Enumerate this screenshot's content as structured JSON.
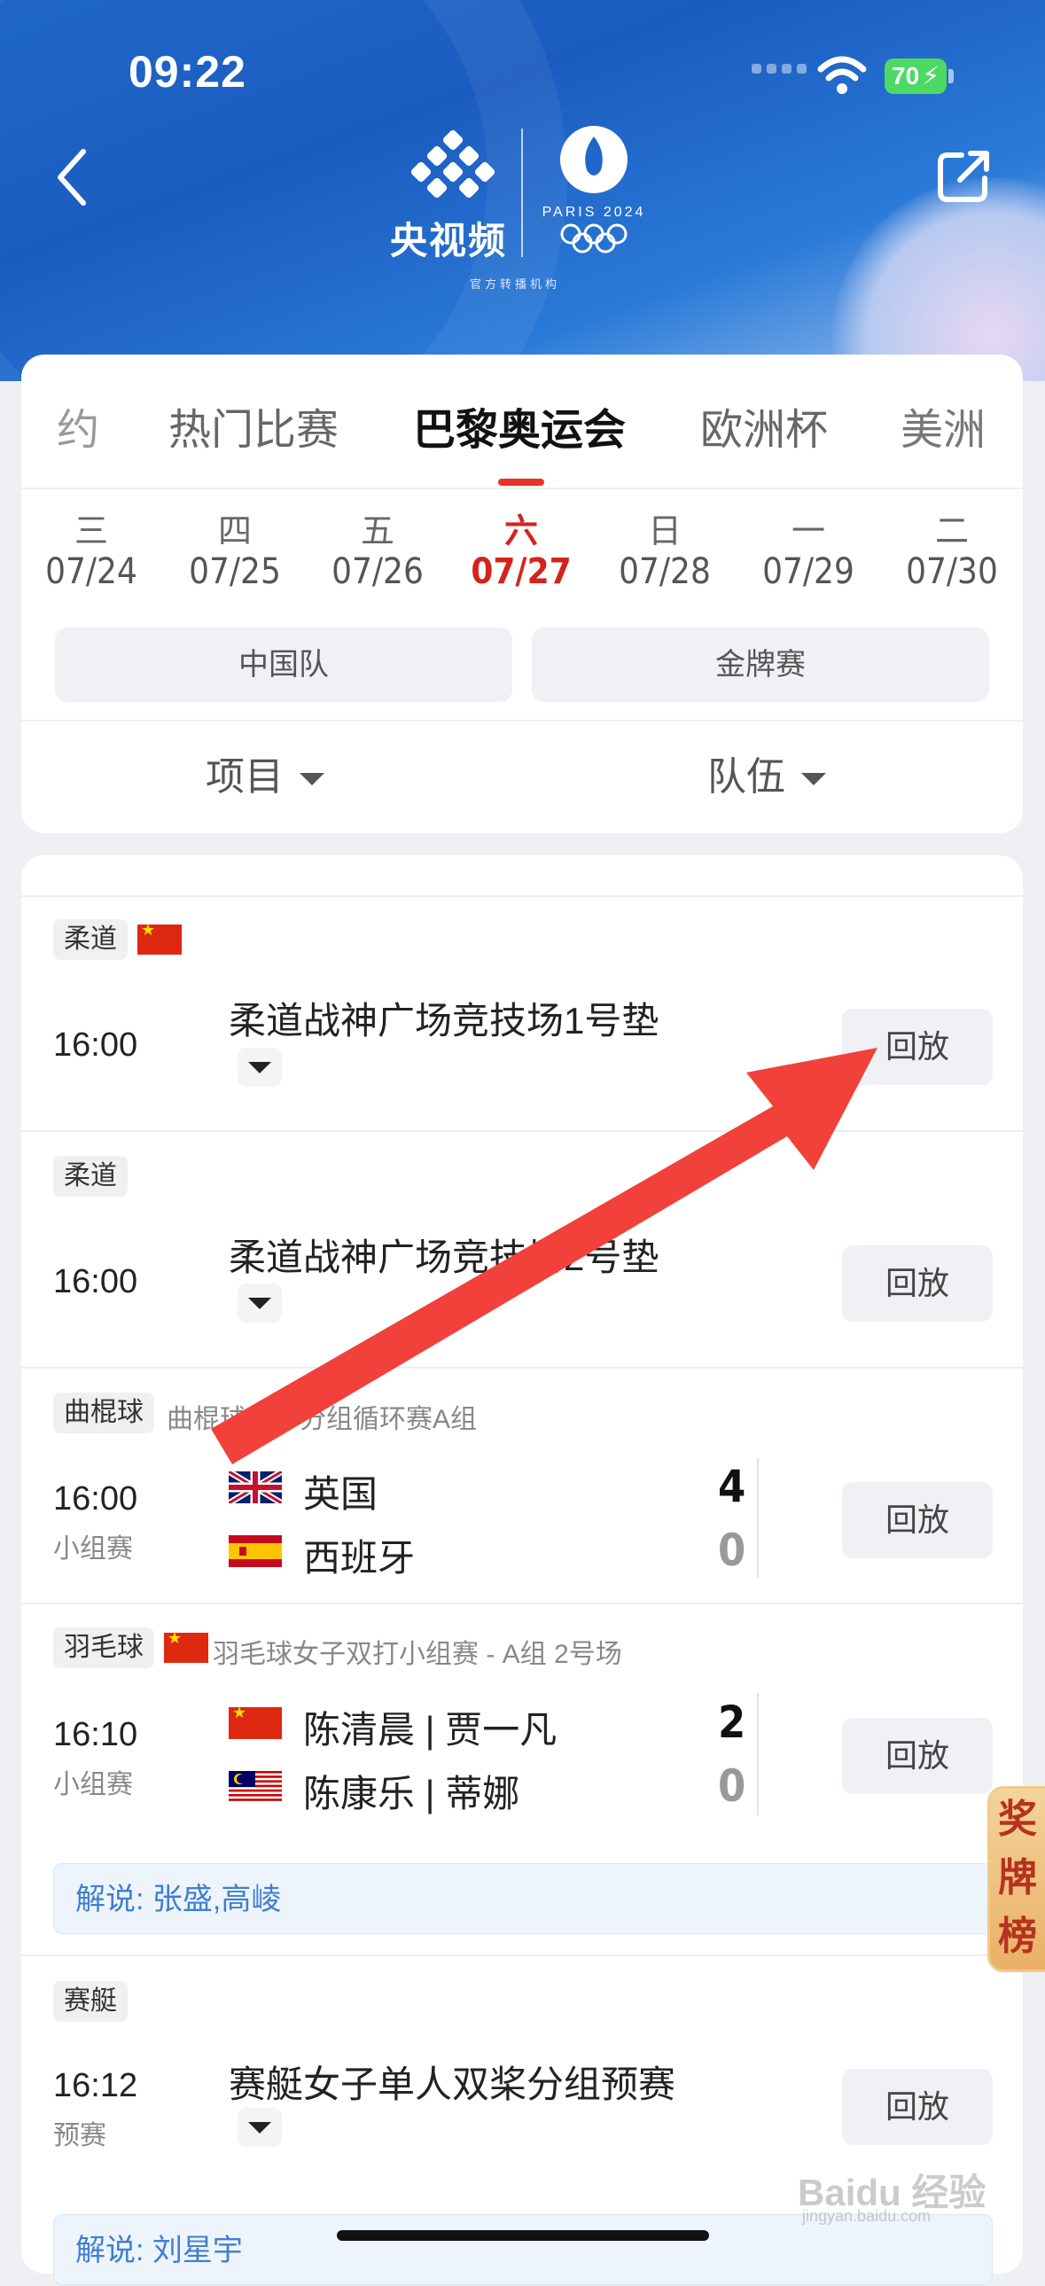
{
  "status": {
    "time": "09:22",
    "battery": "70"
  },
  "header": {
    "brand_name": "央视频",
    "brand_sub": "官方转播机构",
    "paris_label": "PARIS 2024"
  },
  "tabs": [
    "约",
    "热门比赛",
    "巴黎奥运会",
    "欧洲杯",
    "美洲"
  ],
  "active_tab": "巴黎奥运会",
  "days": [
    {
      "wk": "三",
      "dt": "07/24"
    },
    {
      "wk": "四",
      "dt": "07/25"
    },
    {
      "wk": "五",
      "dt": "07/26"
    },
    {
      "wk": "六",
      "dt": "07/27"
    },
    {
      "wk": "日",
      "dt": "07/28"
    },
    {
      "wk": "一",
      "dt": "07/29"
    },
    {
      "wk": "二",
      "dt": "07/30"
    }
  ],
  "active_day": "07/27",
  "filters": {
    "china_team": "中国队",
    "gold_match": "金牌赛"
  },
  "dropdowns": {
    "project": "项目",
    "team": "队伍"
  },
  "replay_label": "回放",
  "matches": [
    {
      "tag": "柔道",
      "time": "16:00",
      "venue": "柔道战神广场竞技场1号垫"
    },
    {
      "tag": "柔道",
      "time": "16:00",
      "venue": "柔道战神广场竞技场2号垫"
    },
    {
      "tag": "曲棍球",
      "subtitle": "曲棍球男子分组循环赛A组",
      "time": "16:00",
      "stage": "小组赛",
      "teams": [
        {
          "name": "英国",
          "score": "4"
        },
        {
          "name": "西班牙",
          "score": "0"
        }
      ]
    },
    {
      "tag": "羽毛球",
      "subtitle": "羽毛球女子双打小组赛 - A组 2号场",
      "time": "16:10",
      "stage": "小组赛",
      "teams": [
        {
          "name": "陈清晨 | 贾一凡",
          "score": "2"
        },
        {
          "name": "陈康乐 | 蒂娜",
          "score": "0"
        }
      ],
      "commentary": "解说: 张盛,高崚"
    },
    {
      "tag": "赛艇",
      "time": "16:12",
      "stage": "预赛",
      "venue": "赛艇女子单人双桨分组预赛",
      "commentary": "解说: 刘星宇"
    }
  ],
  "medal_table": [
    "奖",
    "牌",
    "榜"
  ],
  "watermark": {
    "main": "Baidu 经验",
    "sub": "jingyan.baidu.com"
  },
  "colors": {
    "accent_red": "#d5231c",
    "header_blue": "#1f67c9",
    "commentary_blue": "#3f7fd1"
  }
}
